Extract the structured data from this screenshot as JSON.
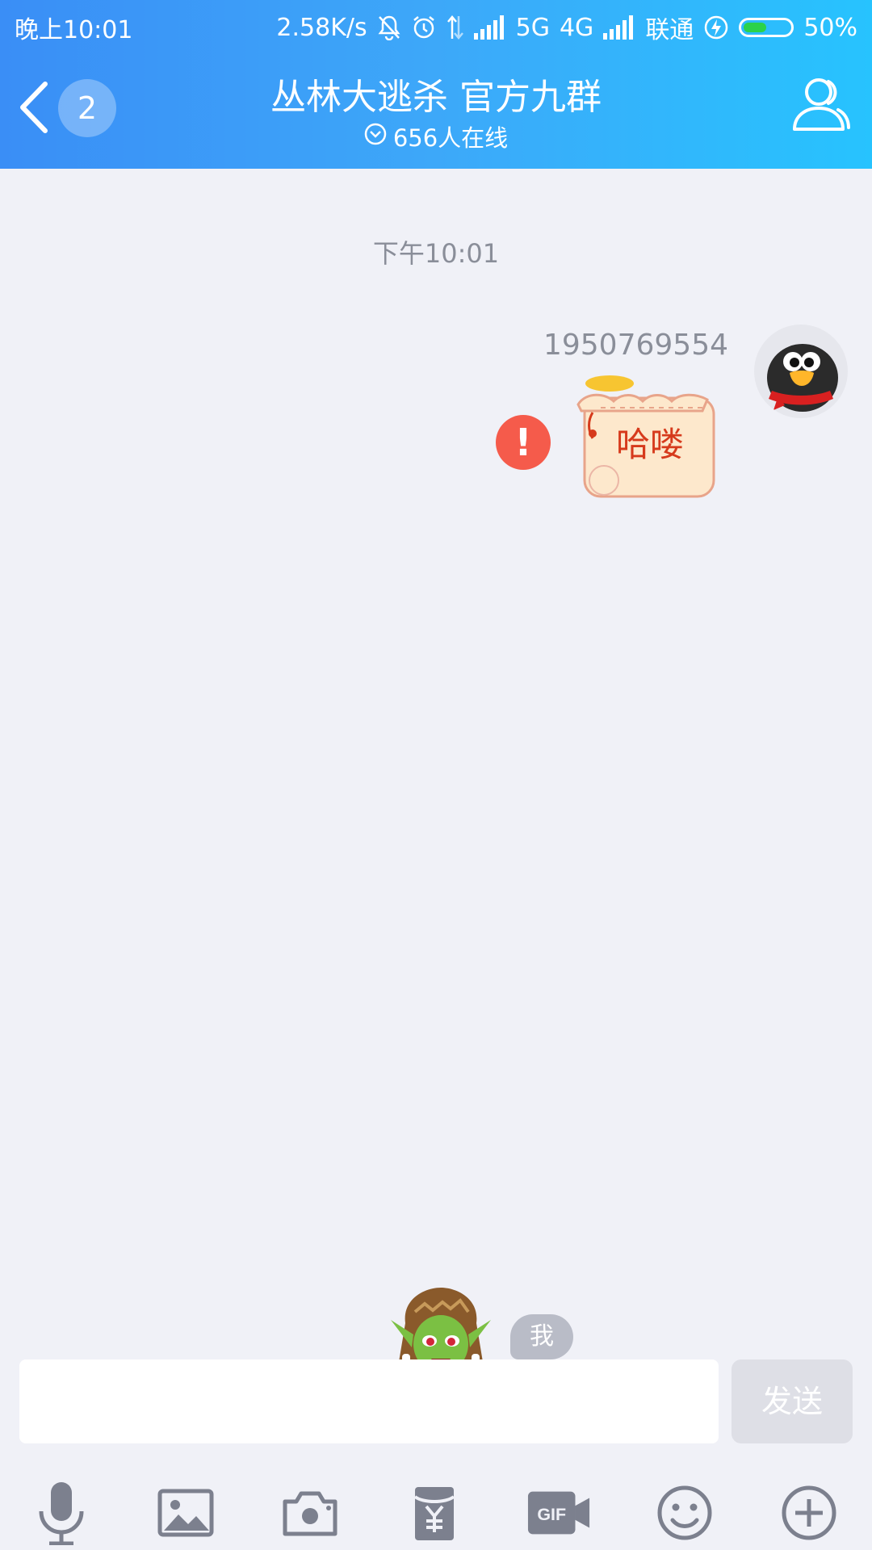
{
  "status_bar": {
    "time": "晚上10:01",
    "speed": "2.58K/s",
    "network_5g": "5G",
    "network_4g": "4G",
    "carrier": "联通",
    "battery": "50%",
    "battery_level": 0.5
  },
  "header": {
    "unread_count": "2",
    "title": "丛林大逃杀 官方九群",
    "online": "656人在线"
  },
  "chat": {
    "timestamp": "下午10:01",
    "message": {
      "sender": "1950769554",
      "sticker_text": "哈喽"
    },
    "me_label": "我"
  },
  "input": {
    "value": "",
    "send_label": "发送"
  },
  "toolbar": {
    "items": [
      "voice-icon",
      "image-icon",
      "camera-icon",
      "red-packet-icon",
      "gif-icon",
      "emoji-icon",
      "plus-icon"
    ]
  },
  "colors": {
    "header_start": "#3A8EF6",
    "header_end": "#27C3FE",
    "background": "#F0F1F7",
    "error": "#F55B4B",
    "icon": "#7C808E"
  }
}
